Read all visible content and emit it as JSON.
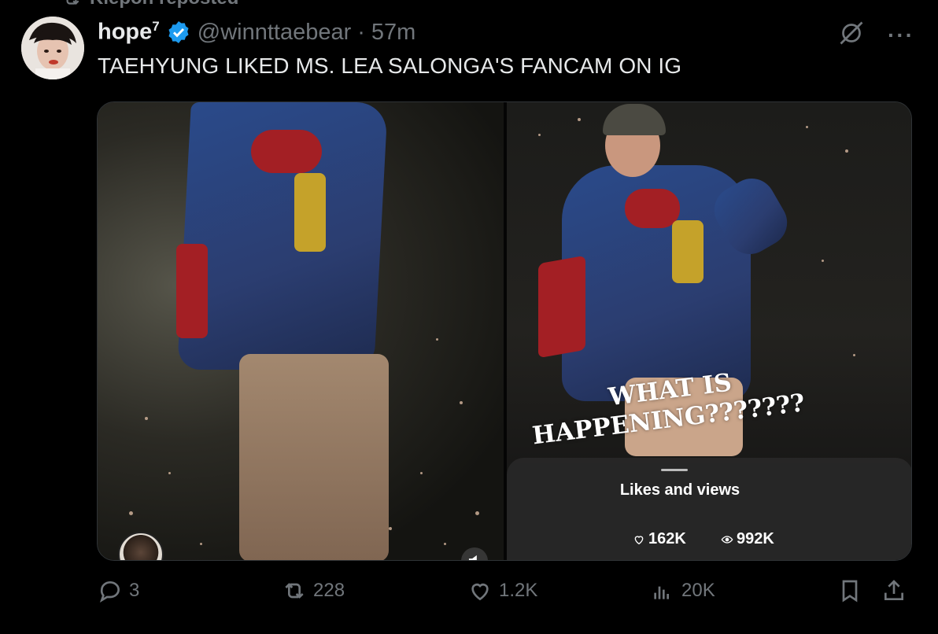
{
  "repost": {
    "label": "Kiepon reposted"
  },
  "author": {
    "name": "hope",
    "name_superscript": "7",
    "handle": "@winnttaebear",
    "separator": "·",
    "time": "57m",
    "verified": true
  },
  "tweet": {
    "text": "TAEHYUNG LIKED MS. LEA SALONGA'S FANCAM ON IG"
  },
  "media": {
    "overlay_line1": "WHAT IS",
    "overlay_line2": "HAPPENING???????",
    "stats_title": "Likes and views",
    "likes": "162K",
    "views": "992K"
  },
  "actions": {
    "replies": "3",
    "reposts": "228",
    "likes": "1.2K",
    "views": "20K"
  },
  "colors": {
    "background": "#000000",
    "text": "#e7e9ea",
    "muted": "#71767b",
    "verified": "#1d9bf0"
  }
}
